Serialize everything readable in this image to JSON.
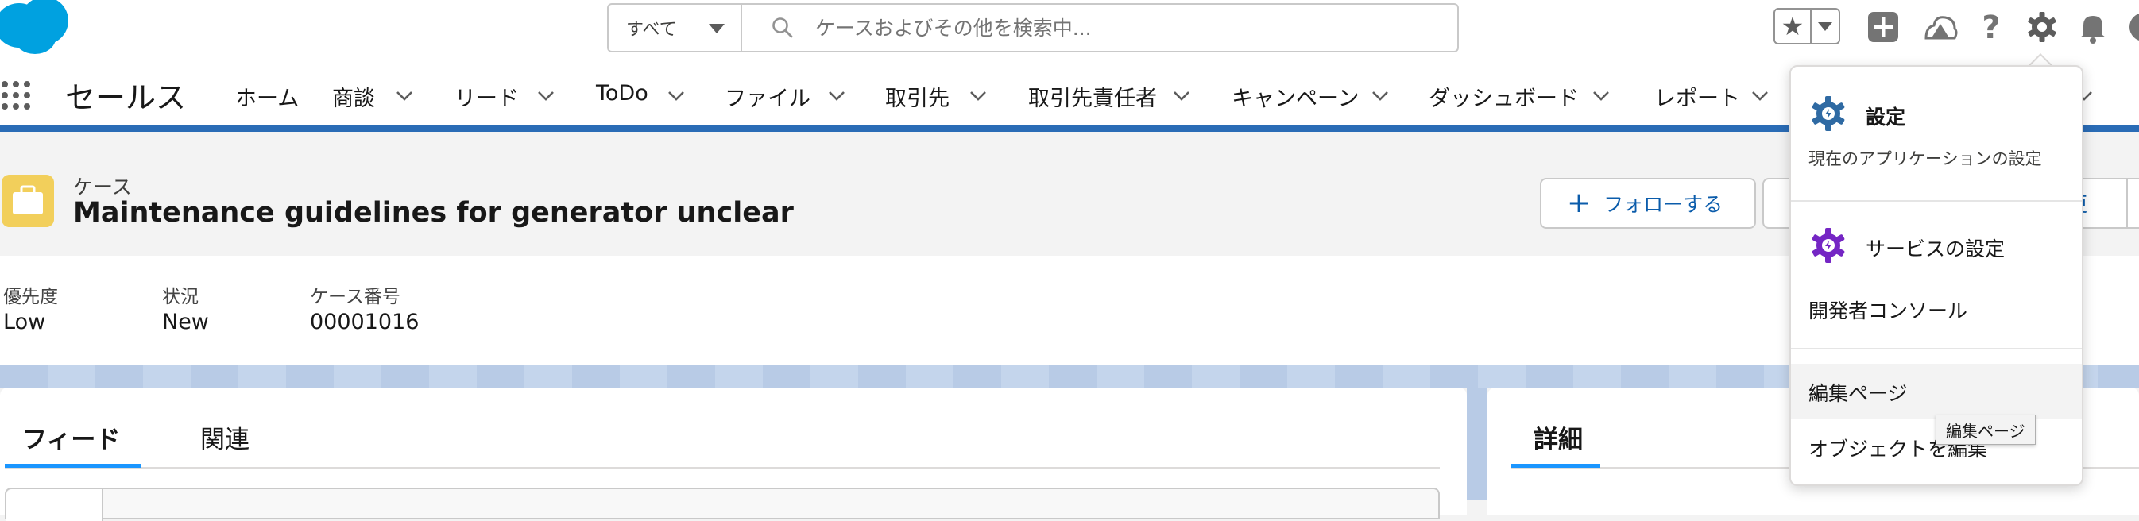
{
  "header": {
    "search_scope": "すべて",
    "search_placeholder": "ケースおよびその他を検索中..."
  },
  "nav": {
    "app_name": "セールス",
    "items": [
      {
        "label": "ホーム",
        "has_menu": false
      },
      {
        "label": "商談",
        "has_menu": true
      },
      {
        "label": "リード",
        "has_menu": true
      },
      {
        "label": "ToDo",
        "has_menu": true
      },
      {
        "label": "ファイル",
        "has_menu": true
      },
      {
        "label": "取引先",
        "has_menu": true
      },
      {
        "label": "取引先責任者",
        "has_menu": true
      },
      {
        "label": "キャンペーン",
        "has_menu": true
      },
      {
        "label": "ダッシュボード",
        "has_menu": true
      },
      {
        "label": "レポート",
        "has_menu": true
      }
    ]
  },
  "record": {
    "object_label": "ケース",
    "title": "Maintenance guidelines for generator unclear",
    "follow_label": "フォローする",
    "partial_button": "更",
    "highlights": [
      {
        "label": "優先度",
        "value": "Low"
      },
      {
        "label": "状況",
        "value": "New"
      },
      {
        "label": "ケース番号",
        "value": "00001016"
      }
    ]
  },
  "tabs_left": [
    {
      "label": "フィード",
      "active": true
    },
    {
      "label": "関連",
      "active": false
    }
  ],
  "tabs_right": [
    {
      "label": "詳細",
      "active": true
    }
  ],
  "setup_menu": {
    "setup_title": "設定",
    "setup_subtitle": "現在のアプリケーションの設定",
    "service_setup": "サービスの設定",
    "developer_console": "開発者コンソール",
    "edit_page": "編集ページ",
    "edit_object": "オブジェクトを編集",
    "tooltip": "編集ページ"
  },
  "colors": {
    "brand_blue": "#2a6cb6",
    "link_blue": "#0b5cab",
    "case_icon": "#f2cf5b",
    "setup_icon": "#2f6aa3",
    "service_icon": "#7526c4"
  }
}
